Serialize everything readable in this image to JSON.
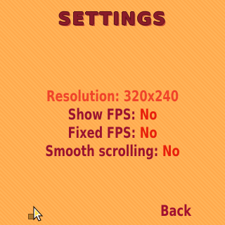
{
  "screen": {
    "title": "SETTINGS",
    "back_label": "Back"
  },
  "menu": [
    {
      "label": "Resolution: ",
      "value": "320x240",
      "selected": true
    },
    {
      "label": "Show FPS: ",
      "value": "No",
      "selected": false
    },
    {
      "label": "Fixed FPS: ",
      "value": "No",
      "selected": false
    },
    {
      "label": "Smooth scrolling: ",
      "value": "No",
      "selected": false
    }
  ],
  "icons": {
    "cursor": "pointer-cursor-icon"
  },
  "colors": {
    "background": "#ffb45a",
    "title": "#8a1c2a",
    "label": "#9a1230",
    "value": "#e8200c",
    "selected": "#f0442a"
  }
}
